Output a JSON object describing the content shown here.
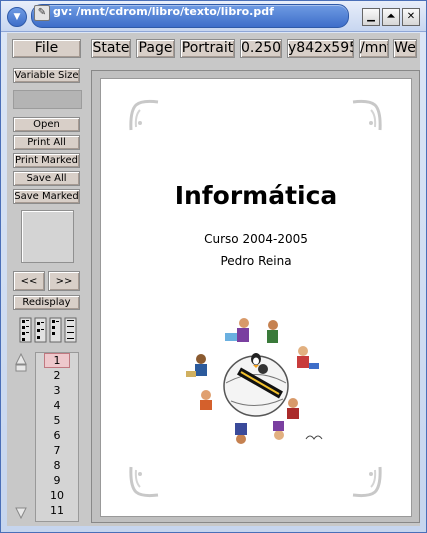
{
  "window": {
    "title": "gv: /mnt/cdrom/libro/texto/libro.pdf",
    "minimize_glyph": "▁",
    "maximize_glyph": "⏶",
    "close_glyph": "✕"
  },
  "toolbar": {
    "file": "File",
    "state": "State",
    "page": "Page",
    "orientation": "Portrait",
    "scale": "0.250",
    "size": "y842x595",
    "path": "/mnt",
    "we": "We"
  },
  "sidebar": {
    "variable_size": "Variable Size",
    "open": "Open",
    "print_all": "Print All",
    "print_marked": "Print Marked",
    "save_all": "Save All",
    "save_marked": "Save Marked",
    "prev": "<<",
    "next": ">>",
    "redisplay": "Redisplay"
  },
  "page_list": [
    "1",
    "2",
    "3",
    "4",
    "5",
    "6",
    "7",
    "8",
    "9",
    "10",
    "11"
  ],
  "selected_page": "1",
  "document": {
    "title": "Informática",
    "course": "Curso 2004-2005",
    "author": "Pedro Reina"
  },
  "colors": {
    "button_face": "#d8cfc8",
    "title_blue": "#3e6ec9",
    "selected_page": "#eec8cc"
  }
}
